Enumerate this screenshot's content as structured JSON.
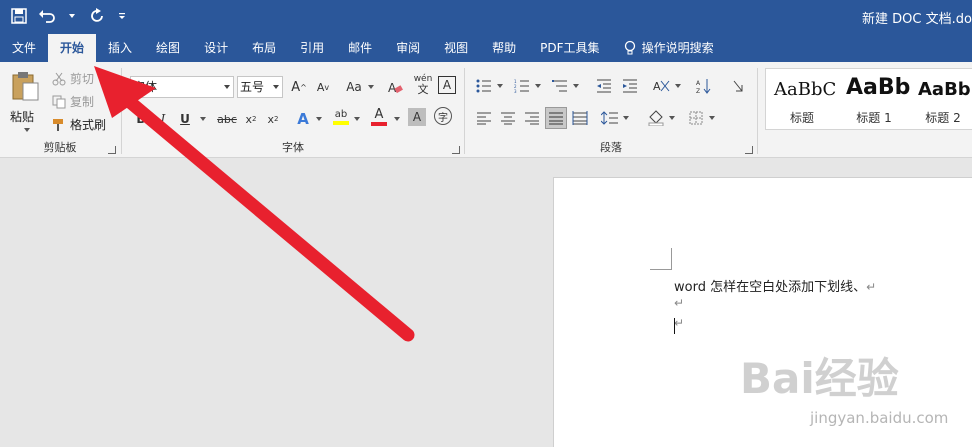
{
  "colors": {
    "titlebar": "#2b579a",
    "ribbon": "#f3f3f3",
    "arrow": "#e8212e"
  },
  "document_title": "新建 DOC 文档.do",
  "qat": {
    "save_icon": "save-icon",
    "undo_icon": "undo-icon",
    "redo_icon": "repeat-icon",
    "customize_icon": "customize-qat-icon"
  },
  "tabs": [
    {
      "label": "文件"
    },
    {
      "label": "开始"
    },
    {
      "label": "插入"
    },
    {
      "label": "绘图"
    },
    {
      "label": "设计"
    },
    {
      "label": "布局"
    },
    {
      "label": "引用"
    },
    {
      "label": "邮件"
    },
    {
      "label": "审阅"
    },
    {
      "label": "视图"
    },
    {
      "label": "帮助"
    },
    {
      "label": "PDF工具集"
    },
    {
      "label": "操作说明搜索"
    }
  ],
  "clipboard": {
    "paste": "粘贴",
    "cut": "剪切",
    "copy": "复制",
    "format_painter": "格式刷",
    "group_label": "剪贴板"
  },
  "font": {
    "name": "宋体",
    "size": "五号",
    "group_label": "字体",
    "case_label": "Aa",
    "phonetic_label": "wén"
  },
  "paragraph": {
    "group_label": "段落"
  },
  "styles": [
    {
      "sample": "AaBbC",
      "name": "标题"
    },
    {
      "sample": "AaBb",
      "name": "标题 1"
    },
    {
      "sample": "AaBb",
      "name": "标题 2"
    }
  ],
  "document": {
    "line1": "word 怎样在空白处添加下划线、",
    "para_mark": "↵"
  },
  "watermark": {
    "brand": "Bai经验",
    "url": "jingyan.baidu.com"
  }
}
